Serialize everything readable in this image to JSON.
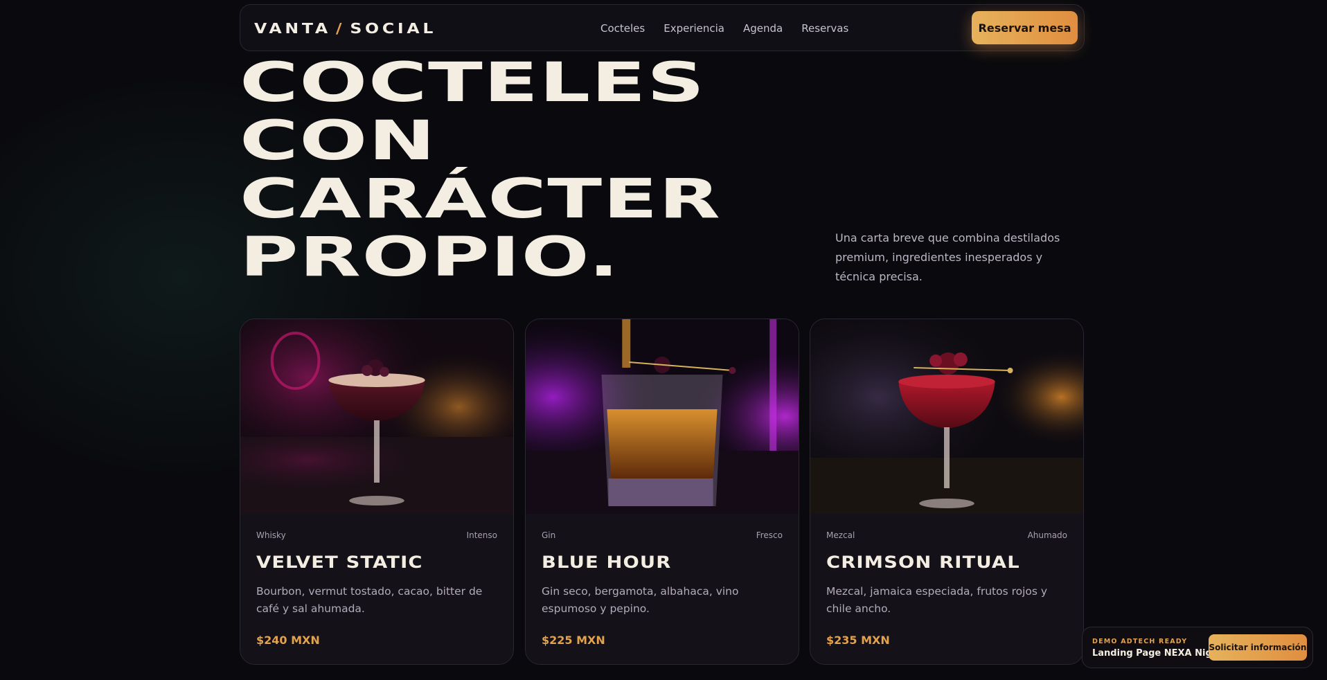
{
  "nav": {
    "logo_left": "VANTA",
    "logo_slash": "/",
    "logo_right": "SOCIAL",
    "links": [
      "Cocteles",
      "Experiencia",
      "Agenda",
      "Reservas"
    ],
    "cta": "Reservar mesa"
  },
  "hero": {
    "lines": [
      "COCTELES",
      "CON",
      "CARÁCTER",
      "PROPIO."
    ],
    "description": "Una carta breve que combina destilados premium, ingredientes inesperados y técnica precisa."
  },
  "cocktails": [
    {
      "spirit": "Whisky",
      "profile": "Intenso",
      "name": "VELVET STATIC",
      "description": "Bourbon, vermut tostado, cacao, bitter de café y sal ahumada.",
      "price": "$240 MXN",
      "image": "coupe-glass-photo"
    },
    {
      "spirit": "Gin",
      "profile": "Fresco",
      "name": "BLUE HOUR",
      "description": "Gin seco, bergamota, albahaca, vino espumoso y pepino.",
      "price": "$225 MXN",
      "image": "rocks-glass-photo"
    },
    {
      "spirit": "Mezcal",
      "profile": "Ahumado",
      "name": "CRIMSON RITUAL",
      "description": "Mezcal, jamaica especiada, frutos rojos y chile ancho.",
      "price": "$235 MXN",
      "image": "coupe-glass-photo"
    }
  ],
  "badge": {
    "tag": "DEMO ADTECH READY",
    "title": "Landing Page NEXA Night",
    "cta": "Solicitar información"
  },
  "colors": {
    "accent": "#e3a24b",
    "background": "#0a0a0e",
    "text": "#f3ede2"
  }
}
